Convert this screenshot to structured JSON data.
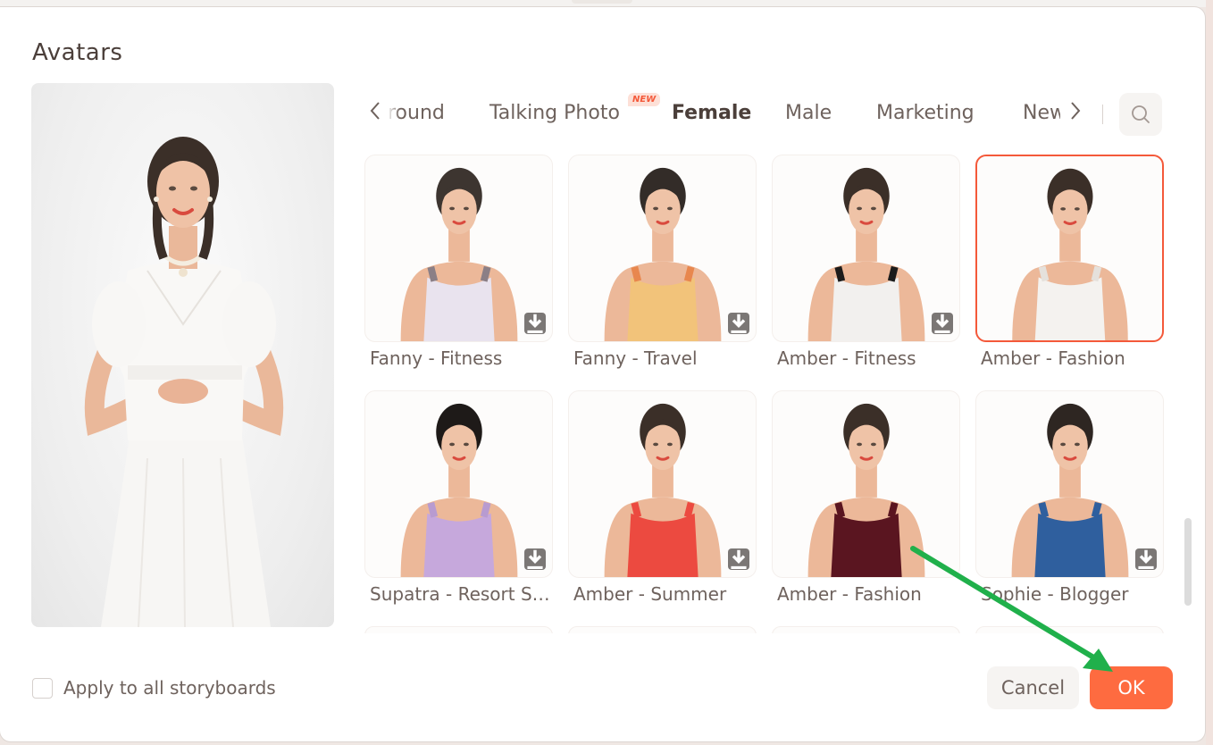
{
  "dialog": {
    "title": "Avatars"
  },
  "preview": {
    "avatar_name": "Amber - Fashion",
    "outfit_color": "#f7f5f2"
  },
  "tabs": {
    "items": [
      {
        "label": "round",
        "state": "partially-hidden"
      },
      {
        "label": "Talking Photo",
        "badge": "NEW"
      },
      {
        "label": "Female",
        "active": true
      },
      {
        "label": "Male"
      },
      {
        "label": "Marketing"
      },
      {
        "label": "New",
        "state": "partially-hidden"
      }
    ],
    "prev_icon": "chevron-left-icon",
    "next_icon": "chevron-right-icon",
    "search_icon": "search-icon"
  },
  "avatars": [
    {
      "name": "Fanny - Fitness",
      "top": "#e9e3ee",
      "strap": "#8b7f86",
      "hair": "#3d3530",
      "downloadable": true,
      "selected": false
    },
    {
      "name": "Fanny - Travel",
      "top": "#f2c37a",
      "strap": "#e8874e",
      "hair": "#332c28",
      "downloadable": true,
      "selected": false
    },
    {
      "name": "Amber - Fitness",
      "top": "#f2f0ee",
      "strap": "#1c1b1b",
      "hair": "#3b2f28",
      "downloadable": true,
      "selected": false
    },
    {
      "name": "Amber - Fashion",
      "top": "#f4f2ef",
      "strap": "#e5e1dc",
      "hair": "#3b2f28",
      "downloadable": false,
      "selected": true
    },
    {
      "name": "Supatra - Resort Style",
      "top": "#c6a8dc",
      "strap": "#b89bd0",
      "hair": "#1e1a18",
      "downloadable": true,
      "selected": false
    },
    {
      "name": "Amber - Summer",
      "top": "#ec4a40",
      "strap": "#ec4a40",
      "hair": "#3b2f28",
      "downloadable": true,
      "selected": false
    },
    {
      "name": "Amber - Fashion",
      "top": "#5a1520",
      "strap": "#5a1520",
      "hair": "#3b2f28",
      "downloadable": false,
      "selected": false
    },
    {
      "name": "Sophie - Blogger",
      "top": "#2f5f9e",
      "strap": "#2f5f9e",
      "hair": "#2e2622",
      "downloadable": true,
      "selected": false
    }
  ],
  "footer": {
    "apply_all_label": "Apply to all storyboards",
    "apply_all_checked": false,
    "cancel_label": "Cancel",
    "ok_label": "OK"
  },
  "colors": {
    "accent": "#fe6b40",
    "selected_border": "#f4593a",
    "annotation_arrow": "#20b04b"
  }
}
